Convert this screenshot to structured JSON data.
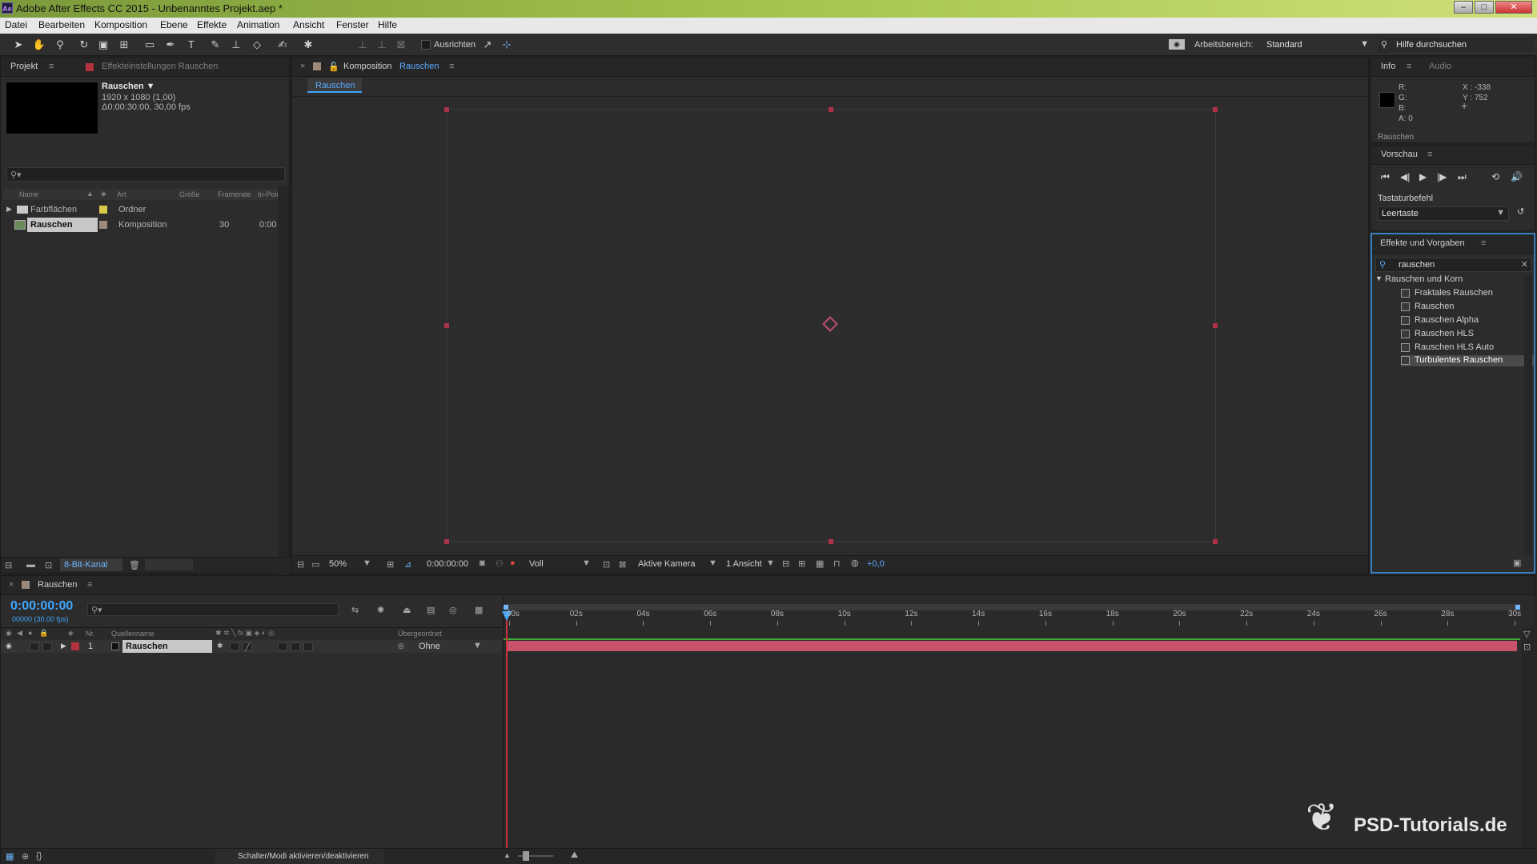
{
  "window": {
    "app_icon": "Ae",
    "title": "Adobe After Effects CC 2015 - Unbenanntes Projekt.aep *"
  },
  "menu": [
    "Datei",
    "Bearbeiten",
    "Komposition",
    "Ebene",
    "Effekte",
    "Animation",
    "Ansicht",
    "Fenster",
    "Hilfe"
  ],
  "toolbar": {
    "align_label": "Ausrichten",
    "workspace_label": "Arbeitsbereich:",
    "workspace_value": "Standard",
    "help_search": "Hilfe durchsuchen"
  },
  "project": {
    "tab_project": "Projekt",
    "tab_effects": "Effekteinstellungen Rauschen",
    "item_name": "Rauschen ▼",
    "item_size": "1920 x 1080 (1,00)",
    "item_duration": "Δ0:00:30:00, 30,00 fps",
    "search_placeholder": "",
    "columns": [
      "Name",
      "Art",
      "Größe",
      "Framerate",
      "In-Point"
    ],
    "rows": [
      {
        "name": "Farbflächen",
        "type": "Ordner",
        "framerate": "",
        "inpoint": ""
      },
      {
        "name": "Rauschen",
        "type": "Komposition",
        "framerate": "30",
        "inpoint": "0:00"
      }
    ],
    "bit_depth": "8-Bit-Kanal"
  },
  "composition": {
    "tab_label": "Komposition",
    "tab_name": "Rauschen",
    "flow_button": "Rauschen",
    "zoom": "50%",
    "timecode": "0:00:00:00",
    "resolution": "Voll",
    "camera": "Aktive Kamera",
    "views": "1 Ansicht",
    "exposure": "+0,0"
  },
  "info": {
    "tab_info": "Info",
    "tab_audio": "Audio",
    "r": "R:",
    "g": "G:",
    "b": "B:",
    "a": "A:  0",
    "x": "X : -338",
    "y": "Y : 752",
    "footer": "Rauschen"
  },
  "preview": {
    "title": "Vorschau",
    "shortcut_label": "Tastaturbefehl",
    "shortcut_value": "Leertaste"
  },
  "effects": {
    "title": "Effekte und Vorgaben",
    "search_value": "rauschen",
    "category": "Rauschen und Korn",
    "items": [
      "Fraktales Rauschen",
      "Rauschen",
      "Rauschen Alpha",
      "Rauschen HLS",
      "Rauschen HLS Auto",
      "Turbulentes Rauschen"
    ]
  },
  "timeline": {
    "tab_name": "Rauschen",
    "timecode": "0:00:00:00",
    "frames": "00000 (30.00 fps)",
    "col_nr": "Nr.",
    "col_source": "Quellenname",
    "col_parent": "Übergeordnet",
    "layer": {
      "nr": "1",
      "name": "Rauschen",
      "parent": "Ohne"
    },
    "ticks": [
      ":00s",
      "02s",
      "04s",
      "06s",
      "08s",
      "10s",
      "12s",
      "14s",
      "16s",
      "18s",
      "20s",
      "22s",
      "24s",
      "26s",
      "28s",
      "30s"
    ],
    "footer": "Schalter/Modi aktivieren/deaktivieren"
  },
  "watermark": "PSD-Tutorials.de",
  "colors": {
    "layer_bar": "#c8526a",
    "label_red": "#b3323e",
    "comp_bg": "#2d2d2d",
    "accent_blue": "#3fa6ff"
  }
}
